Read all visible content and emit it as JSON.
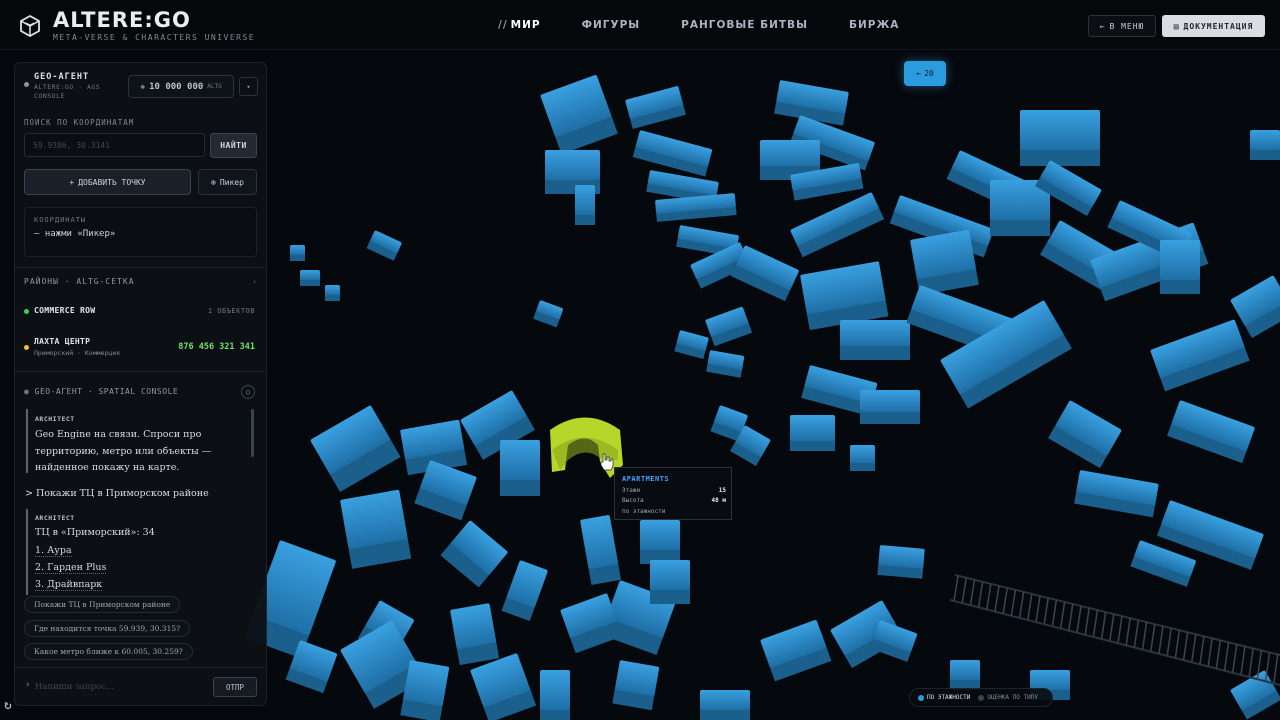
{
  "header": {
    "logo_title": "ALTERE:GO",
    "logo_subtitle": "META-VERSE & CHARACTERS UNIVERSE",
    "nav": [
      {
        "label": "МИР",
        "active": true
      },
      {
        "label": "ФИГУРЫ",
        "active": false
      },
      {
        "label": "РАНГОВЫЕ БИТВЫ",
        "active": false
      },
      {
        "label": "БИРЖА",
        "active": false
      }
    ],
    "nav_active_prefix": "//",
    "menu_button": "В МЕНЮ",
    "docs_button": "ДОКУМЕНТАЦИЯ"
  },
  "zoom": {
    "label": "20",
    "icon": "arrow-left-icon"
  },
  "panel": {
    "title": "GEO-АГЕНТ",
    "subtitle": "ALTERE:GO · AGS CONSOLE",
    "balance_amount": "10 000 000",
    "balance_unit": "ALTG",
    "search_label": "ПОИСК ПО КООРДИНАТАМ",
    "search_placeholder": "59.9386, 30.3141",
    "search_value": "",
    "find_button": "НАЙТИ",
    "add_point_button": "ДОБАВИТЬ ТОЧКУ",
    "picker_button": "Пикер",
    "coords_label": "КООРДИНАТЫ",
    "coords_value": "— нажми «Пикер»",
    "districts_header": "РАЙОНЫ · ALTG-СЕТКА",
    "districts": [
      {
        "name": "COMMERCE ROW",
        "sub": "",
        "right": "1 ОБЪЕКТОВ",
        "dot_color": "#38d45a"
      },
      {
        "name": "ЛАХТА ЦЕНТР",
        "sub": "Приморский · Коммерция",
        "right": "876 456 321 341",
        "dot_color": "#f2c230"
      }
    ],
    "console_header": "GEO-АГЕНТ · SPATIAL CONSOLE",
    "messages": [
      {
        "role": "ARCHITECT",
        "text": "Geo Engine на связи. Спроси про территорию, метро или объекты — найденное покажу на карте."
      },
      {
        "role": "user",
        "text": "> Покажи ТЦ в Приморском районе"
      },
      {
        "role": "ARCHITECT",
        "lines": [
          "ТЦ в «Приморский»: 34",
          "1. Аура",
          "2. Гарден Plus",
          "3. Драйвпарк"
        ]
      }
    ],
    "suggestions": [
      "Покажи ТЦ в Приморском районе",
      "Где находится точка 59.939, 30.315?",
      "Какое метро ближе к 60.005, 30.259?"
    ],
    "query_placeholder": "Напиши запрос...",
    "send_button": "ОТПР"
  },
  "tooltip": {
    "title": "APARTMENTS",
    "rows": [
      {
        "label": "Этажи",
        "value": "15"
      },
      {
        "label": "Высота",
        "value": "48 м"
      },
      {
        "label": "по этажности",
        "value": ""
      }
    ]
  },
  "legend": {
    "items": [
      {
        "label": "ПО ЭТАЖНОСТИ",
        "active": true,
        "color": "#2b9be0"
      },
      {
        "label": "ОЦЕНКА ПО ТИПУ",
        "active": false,
        "color": "#3a444e"
      }
    ]
  },
  "colors": {
    "building": "#2b8fd0",
    "building_side": "#1b5f8c",
    "highlight": "#b8d62a",
    "background": "#05080c"
  }
}
